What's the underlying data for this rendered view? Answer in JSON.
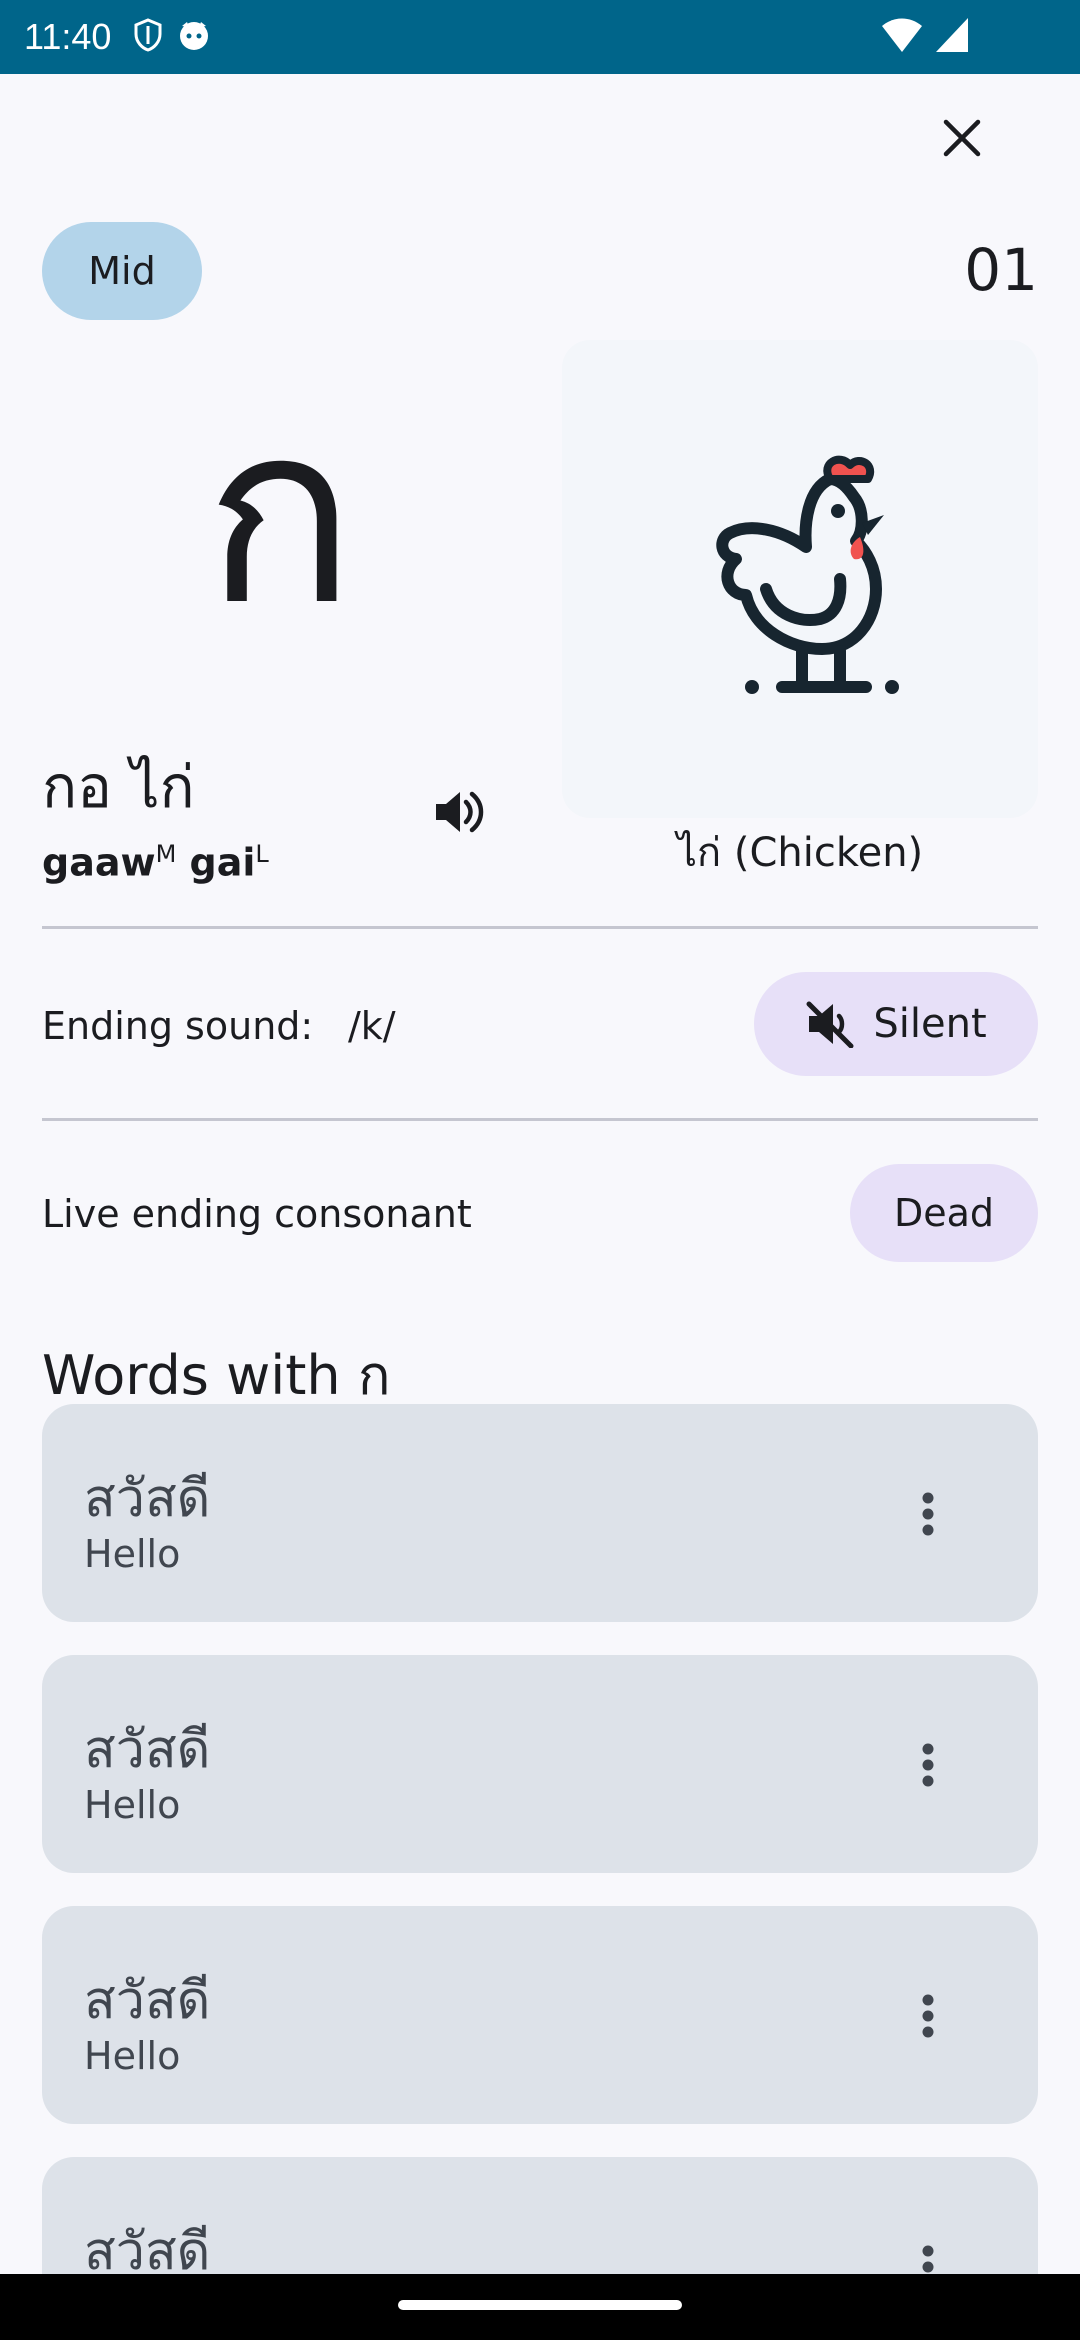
{
  "status": {
    "time": "11:40",
    "icons_left": [
      "shield-icon",
      "cat-icon"
    ],
    "icons_right": [
      "wifi-icon",
      "signal-icon"
    ]
  },
  "header": {
    "close_icon": "close-icon"
  },
  "letter": {
    "class": "Mid",
    "number": "01",
    "character": "ก",
    "thai_name": "กอ ไก่",
    "romanized_1": "gaaw",
    "tone_1": "M",
    "romanized_2": "gai",
    "tone_2": "L",
    "image_caption": "ไก่ (Chicken)",
    "image_icon": "chicken-icon",
    "speaker_icon": "speaker-icon"
  },
  "ending": {
    "label": "Ending sound:",
    "value": "/k/",
    "button_label": "Silent",
    "button_icon": "mute-icon"
  },
  "live": {
    "label": "Live ending consonant",
    "chip": "Dead"
  },
  "words": {
    "heading": "Words with ก",
    "items": [
      {
        "thai": "สวัสดี",
        "meaning": "Hello"
      },
      {
        "thai": "สวัสดี",
        "meaning": "Hello"
      },
      {
        "thai": "สวัสดี",
        "meaning": "Hello"
      },
      {
        "thai": "สวัสดี",
        "meaning": ""
      }
    ]
  },
  "colors": {
    "status_bar": "#00658a",
    "class_chip": "#b3d4ea",
    "tonal_chip": "#e7e0f8",
    "card": "#dde2e9",
    "accent_red": "#f0524f"
  }
}
